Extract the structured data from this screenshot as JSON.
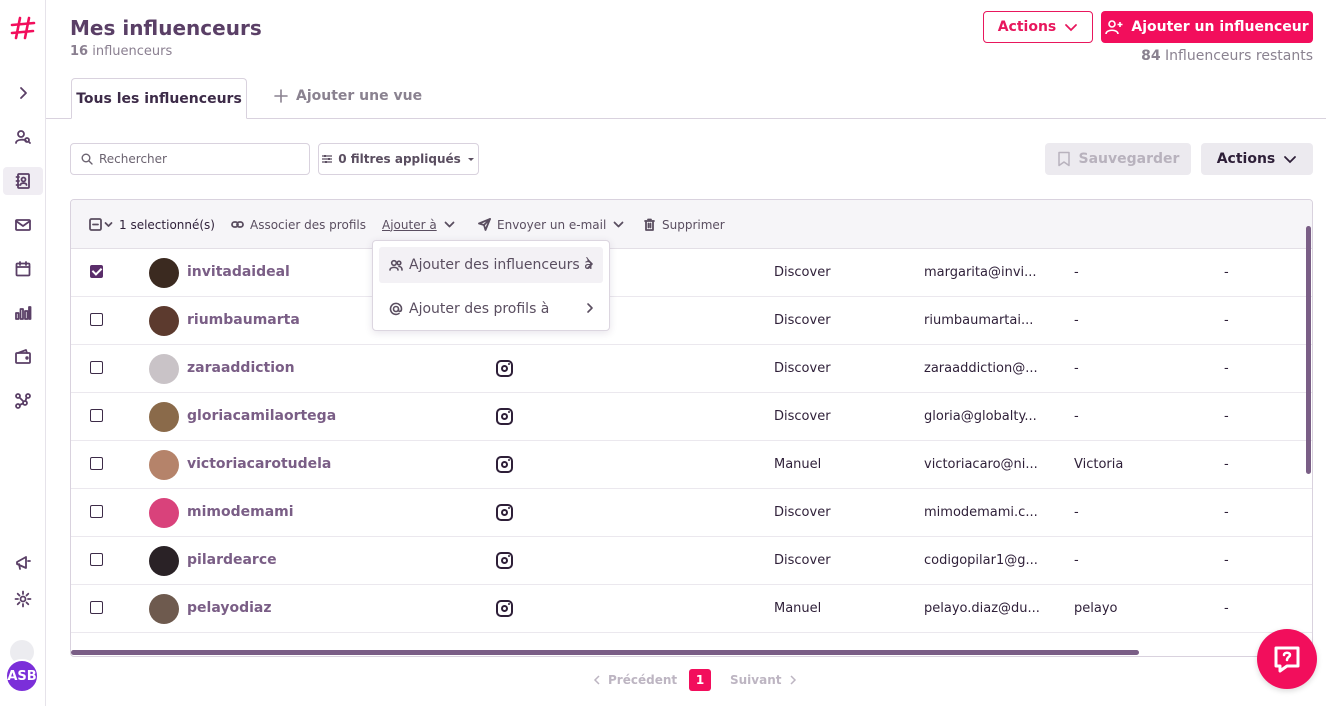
{
  "header": {
    "title": "Mes influenceurs",
    "count": "16",
    "count_label": "influenceurs",
    "actions_label": "Actions",
    "add_label": "Ajouter un influenceur",
    "remaining_count": "84",
    "remaining_label": "Influenceurs restants"
  },
  "tabs": {
    "active": "Tous les influenceurs",
    "add": "Ajouter une vue"
  },
  "filters": {
    "search_placeholder": "Rechercher",
    "filters_label": "0 filtres appliqués",
    "save_label": "Sauvegarder",
    "actions_label": "Actions"
  },
  "toolbar": {
    "selected": "1 selectionné(s)",
    "associate": "Associer des profils",
    "add_to": "Ajouter à",
    "send_email": "Envoyer un e-mail",
    "delete": "Supprimer"
  },
  "dropdown": {
    "item1": "Ajouter des influenceurs à",
    "item2": "Ajouter des profils à"
  },
  "rows": [
    {
      "username": "invitadaideal",
      "instagram": false,
      "source": "Discover",
      "email": "margarita@invi...",
      "name": "-",
      "last": "-",
      "checked": true
    },
    {
      "username": "riumbaumarta",
      "instagram": false,
      "source": "Discover",
      "email": "riumbaumartai...",
      "name": "-",
      "last": "-",
      "checked": false
    },
    {
      "username": "zaraaddiction",
      "instagram": true,
      "source": "Discover",
      "email": "zaraaddiction@...",
      "name": "-",
      "last": "-",
      "checked": false
    },
    {
      "username": "gloriacamilaortega",
      "instagram": true,
      "source": "Discover",
      "email": "gloria@globalty...",
      "name": "-",
      "last": "-",
      "checked": false
    },
    {
      "username": "victoriacarotudela",
      "instagram": true,
      "source": "Manuel",
      "email": "victoriacaro@ni...",
      "name": "Victoria",
      "last": "-",
      "checked": false
    },
    {
      "username": "mimodemami",
      "instagram": true,
      "source": "Discover",
      "email": "mimodemami.c...",
      "name": "-",
      "last": "-",
      "checked": false
    },
    {
      "username": "pilardearce",
      "instagram": true,
      "source": "Discover",
      "email": "codigopilar1@g...",
      "name": "-",
      "last": "-",
      "checked": false
    },
    {
      "username": "pelayodiaz",
      "instagram": true,
      "source": "Manuel",
      "email": "pelayo.diaz@du...",
      "name": "pelayo",
      "last": "-",
      "checked": false
    }
  ],
  "pager": {
    "prev": "Précédent",
    "current": "1",
    "next": "Suivant"
  },
  "user": {
    "initials": "ASB"
  },
  "colors": {
    "accent": "#f20e5c",
    "brand_purple": "#5a3f66"
  }
}
